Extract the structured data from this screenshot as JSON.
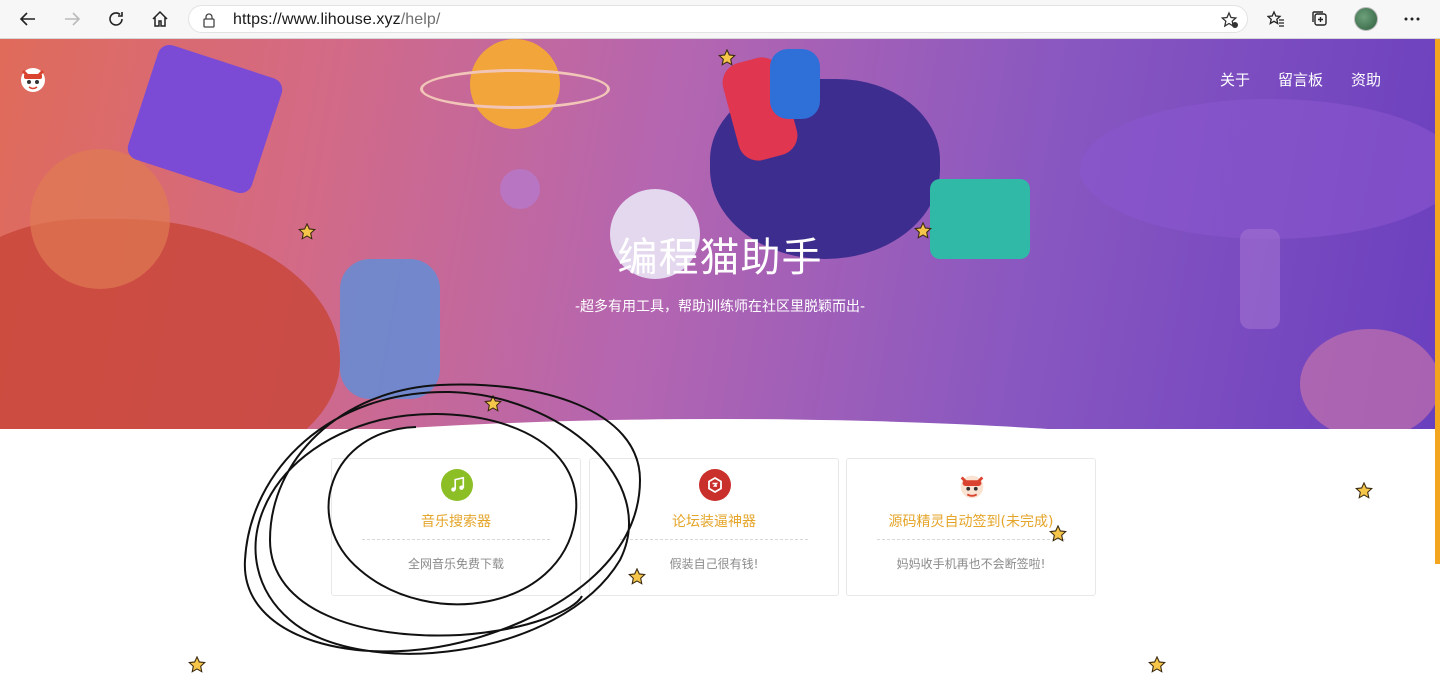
{
  "browser": {
    "url_host": "https://www.lihouse.xyz",
    "url_path": "/help/",
    "buttons": {
      "back": "back-arrow-icon",
      "forward": "forward-arrow-icon",
      "refresh": "refresh-icon",
      "home": "home-icon",
      "favorite_add": "add-favorite-icon",
      "favorites": "favorites-icon",
      "collections": "collections-icon",
      "menu": "more-icon"
    }
  },
  "nav": {
    "about": "关于",
    "guestbook": "留言板",
    "sponsor": "资助"
  },
  "hero": {
    "title": "编程猫助手",
    "subtitle": "-超多有用工具，帮助训练师在社区里脱颖而出-"
  },
  "cards": [
    {
      "title": "音乐搜索器",
      "desc": "全网音乐免费下载",
      "icon": "music-note-icon",
      "color": "#8cbf26"
    },
    {
      "title": "论坛装逼神器",
      "desc": "假装自己很有钱!",
      "icon": "forum-badge-icon",
      "color": "#c9302c"
    },
    {
      "title": "源码精灵自动签到(未完成)",
      "desc": "妈妈收手机再也不会断签啦!",
      "icon": "mascot-icon",
      "color": "#d9432f"
    }
  ],
  "colors": {
    "accent": "#e5a52a",
    "scroll_accent": "#f4a51f"
  }
}
